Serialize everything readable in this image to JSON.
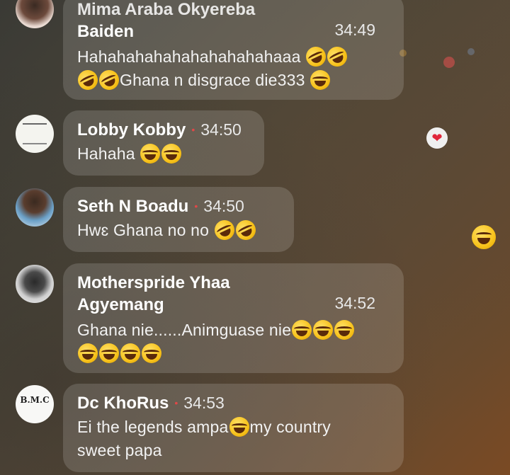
{
  "comments": [
    {
      "name_line1": "Mima Araba Okyereba",
      "name_line2": "Baiden",
      "time": "34:49",
      "text_line1": "Hahahahahahahahahahahaaa",
      "text_line2": "Ghana n disgrace die333",
      "avatar": "profile-photo"
    },
    {
      "name": "Lobby Kobby",
      "time": "34:50",
      "text": "Hahaha",
      "avatar": "profile-photo-text-image"
    },
    {
      "name": "Seth N Boadu",
      "time": "34:50",
      "text": "Hwɛ Ghana no no",
      "avatar": "profile-photo"
    },
    {
      "name_line1": "Motherspride Yhaa",
      "name_line2": "Agyemang",
      "time": "34:52",
      "text_line1": "Ghana nie......Animguase nie",
      "avatar": "profile-photo"
    },
    {
      "name": "Dc KhoRus",
      "time": "34:53",
      "text_line1": "Ei the legends ampa",
      "text_line1b": "my country",
      "text_line2": "sweet papa",
      "avatar": "logo-avatar",
      "avatar_logo_text": "B.M.C"
    }
  ],
  "reactions": {
    "heart_icon": "heart-icon",
    "laugh_icon": "laughing-emoji-icon",
    "colors": {
      "heart": "#e0263a",
      "name_dot": "#e04848",
      "bubble": "rgba(255,255,255,0.15)"
    }
  }
}
